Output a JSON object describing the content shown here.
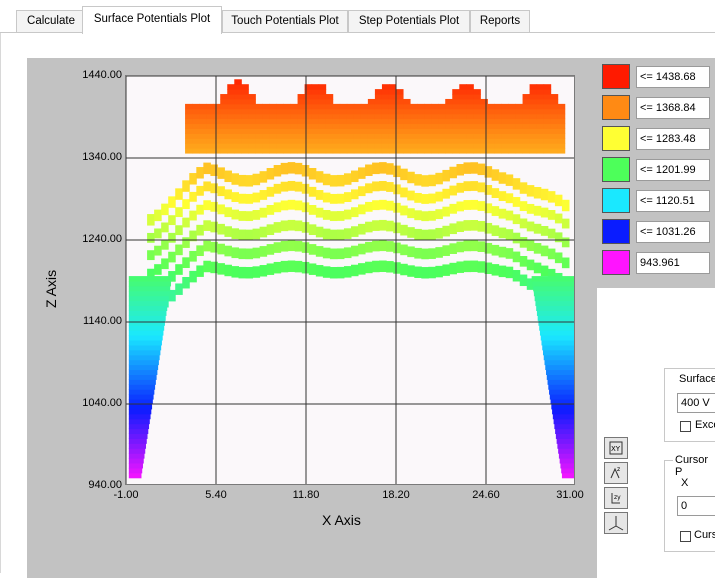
{
  "tabs": [
    "Calculate",
    "Surface Potentials Plot",
    "Touch Potentials Plot",
    "Step Potentials Plot",
    "Reports"
  ],
  "plot": {
    "y_ticks": [
      "1440.00",
      "1340.00",
      "1240.00",
      "1140.00",
      "1040.00",
      "940.00"
    ],
    "x_ticks": [
      "-1.00",
      "5.40",
      "11.80",
      "18.20",
      "24.60",
      "31.00"
    ],
    "xlabel": "X Axis",
    "ylabel": "Z Axis"
  },
  "legend": [
    {
      "color": "#ff1a00",
      "label": "<= 1438.68"
    },
    {
      "color": "#ff8a14",
      "label": "<= 1368.84"
    },
    {
      "color": "#ffff33",
      "label": "<= 1283.48"
    },
    {
      "color": "#4dff5a",
      "label": "<= 1201.99"
    },
    {
      "color": "#1ae8ff",
      "label": "<= 1120.51"
    },
    {
      "color": "#0a1cff",
      "label": "<= 1031.26"
    },
    {
      "color": "#ff14ff",
      "label": "943.961"
    }
  ],
  "surface_group": {
    "title": "Surface",
    "value": "400 V",
    "checkbox_label": "Exce"
  },
  "cursor_group": {
    "title": "Cursor P",
    "x_label": "X",
    "x_value": "0",
    "checkbox_label": "Curs"
  },
  "chart_data": {
    "type": "heatmap",
    "xlabel": "X Axis",
    "ylabel": "Z Axis",
    "xlim": [
      -1.0,
      31.0
    ],
    "ylim": [
      940.0,
      1440.0
    ],
    "x_ticks": [
      -1.0,
      5.4,
      11.8,
      18.2,
      24.6,
      31.0
    ],
    "y_ticks": [
      940.0,
      1040.0,
      1140.0,
      1240.0,
      1340.0,
      1440.0
    ],
    "grid": true,
    "contour_levels": [
      943.961,
      1031.26,
      1120.51,
      1201.99,
      1283.48,
      1368.84,
      1438.68
    ],
    "legend_position": "right"
  }
}
